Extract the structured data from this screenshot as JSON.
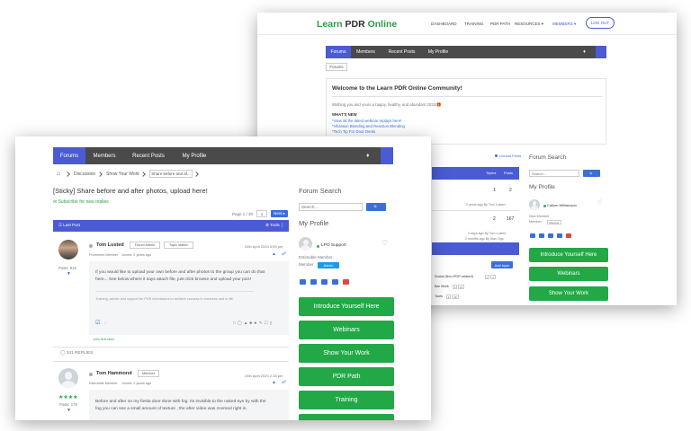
{
  "back": {
    "logo": {
      "learn": "Learn ",
      "pdr": "PDR",
      "online": " Online"
    },
    "topnav": [
      "DASHBOARD",
      "TRAINING",
      "PDR PATH",
      "RESOURCES ▾",
      "MEMBERS ▾"
    ],
    "logout": "LOG OUT",
    "tabs": [
      "Forums",
      "Members",
      "Recent Posts",
      "My Profile"
    ],
    "breadcrumb": "Forums",
    "welcome_title": "Welcome to the Learn PDR Online Community!",
    "welcome_text": "Wishing you and yours a happy, healthy, and abundant 2022!🎁",
    "whats_new": "WHAT'S NEW",
    "links": [
      "*View all the latest webinar replays here!",
      "*Vibration Blending and Reaction Blending",
      "*Tech Tip For Door Dents"
    ],
    "unread_posts": "Unread Posts",
    "col_topics": "Topics",
    "col_posts": "Posts",
    "row1": {
      "topics": "1",
      "posts": "2",
      "meta": "2 years ago  By Tom Lusted"
    },
    "row2": {
      "topics": "2",
      "posts": "167",
      "meta1": "5 days ago  By Tom Lusted",
      "meta2": "2 months ago  By Alan Ogo"
    },
    "add_topic": "Add topic",
    "sub_rows": [
      {
        "label": "Social (Non-PDR related)",
        "b1": "2",
        "b2": "2"
      },
      {
        "label": "Bar Work",
        "b1": "5",
        "b2": "12"
      },
      {
        "label": "Tools",
        "b1": "1",
        "b2": "98"
      }
    ],
    "search_placeholder": "Search...",
    "search_btn": "🔍",
    "profile_title": "My Profile",
    "user_name": "Callum Williamson",
    "user_role": "New Member",
    "user_role2": "Member",
    "user_role2_badge": "Member",
    "green_buttons": [
      "Introduce Yourself Here",
      "Webinars",
      "Show Your Work"
    ]
  },
  "front": {
    "tabs": [
      "Forums",
      "Members",
      "Recent Posts",
      "My Profile"
    ],
    "breadcrumb": [
      "Discussion",
      "Show Your Work",
      "Share before and af..."
    ],
    "topic_title": "[Sticky] Share before and after photos, upload here!",
    "subscribe": "Subscribe for new replies",
    "page_label": "Page 1 / 30",
    "page_num": "1",
    "next": "Next ▸",
    "last_post": "Last Post",
    "tools": "⚙ Tools │",
    "post1": {
      "author": "Tom Lusted",
      "badge1": "Forum Admin",
      "badge2": "Topic starter",
      "date": "24th April 2020 3:59 pm",
      "role": "Prominent Member",
      "joined": "Joined: 2 years ago",
      "posts": "Posts: 918",
      "text1": "If you would like to upload your own before and after photos to the group you can do that",
      "text2": "here... See below where it says attach file, just click browse and upload your pics!",
      "sig": "Training, advice and support for PDR technicians to achieve success in business and in life",
      "liked": "John Holt liked"
    },
    "replies": "341 REPLIES",
    "post2": {
      "author": "Tom Hammond",
      "badge1": "Member",
      "date": "24th April 2020 2:18 pm",
      "role": "Estimable Member",
      "joined": "Joined: 2 years ago",
      "posts": "Posts: 178",
      "text1": "Before and after on my fiesta door done with fog. Its invisible to the naked eye by with the",
      "text2": "fog you can see a small amount of texture , the after video was zoomed right in."
    },
    "search_title": "Forum Search",
    "search_placeholder": "Search...",
    "search_btn": "🔍",
    "profile_title": "My Profile",
    "user_name": "LPO Support",
    "user_role": "Estimable Member",
    "member_label": "Member",
    "member_badge": "Admin",
    "green_buttons": [
      "Introduce Yourself Here",
      "Webinars",
      "Show Your Work",
      "PDR Path",
      "Training"
    ]
  },
  "colors": {
    "accent": "#4a5bd4",
    "green": "#22a846",
    "nav": "#4a4a4a"
  }
}
